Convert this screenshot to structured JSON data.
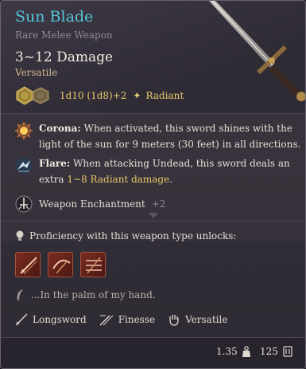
{
  "item": {
    "name": "Sun Blade",
    "rarity": "Rare Melee Weapon",
    "damage": "3~12 Damage",
    "tag": "Versatile"
  },
  "damage_row": {
    "formula": "1d10 (1d8)+2",
    "type_label": "Radiant"
  },
  "effects": [
    {
      "name": "Corona:",
      "text": "When activated, this sword shines with the light of the sun for 9 meters (30 feet) in all directions.",
      "icon": "sunburst-icon"
    },
    {
      "name": "Flare:",
      "text_before": "When attacking Undead, this sword deals an extra",
      "highlight": "1~8 Radiant damage",
      "text_after": ".",
      "icon": "flare-icon"
    }
  ],
  "enchantment": {
    "label": "Weapon Enchantment",
    "value": "+2",
    "icon": "sword-ring-icon"
  },
  "proficiency": {
    "label": "Proficiency with this weapon type unlocks:",
    "icon": "lightbulb-icon",
    "actions": [
      {
        "icon": "slash-action-icon"
      },
      {
        "icon": "cleave-action-icon"
      },
      {
        "icon": "lacerate-action-icon"
      }
    ]
  },
  "flavor": {
    "text": "...In the palm of my hand.",
    "icon": "feather-icon"
  },
  "properties": [
    {
      "label": "Longsword",
      "icon": "longsword-icon"
    },
    {
      "label": "Finesse",
      "icon": "finesse-icon"
    },
    {
      "label": "Versatile",
      "icon": "hand-icon"
    }
  ],
  "footer": {
    "weight": "1.35",
    "value": "125"
  },
  "colors": {
    "title": "#57c4d6",
    "highlight": "#e8c86a",
    "muted": "#8f8a93",
    "panel": "#332f38"
  }
}
